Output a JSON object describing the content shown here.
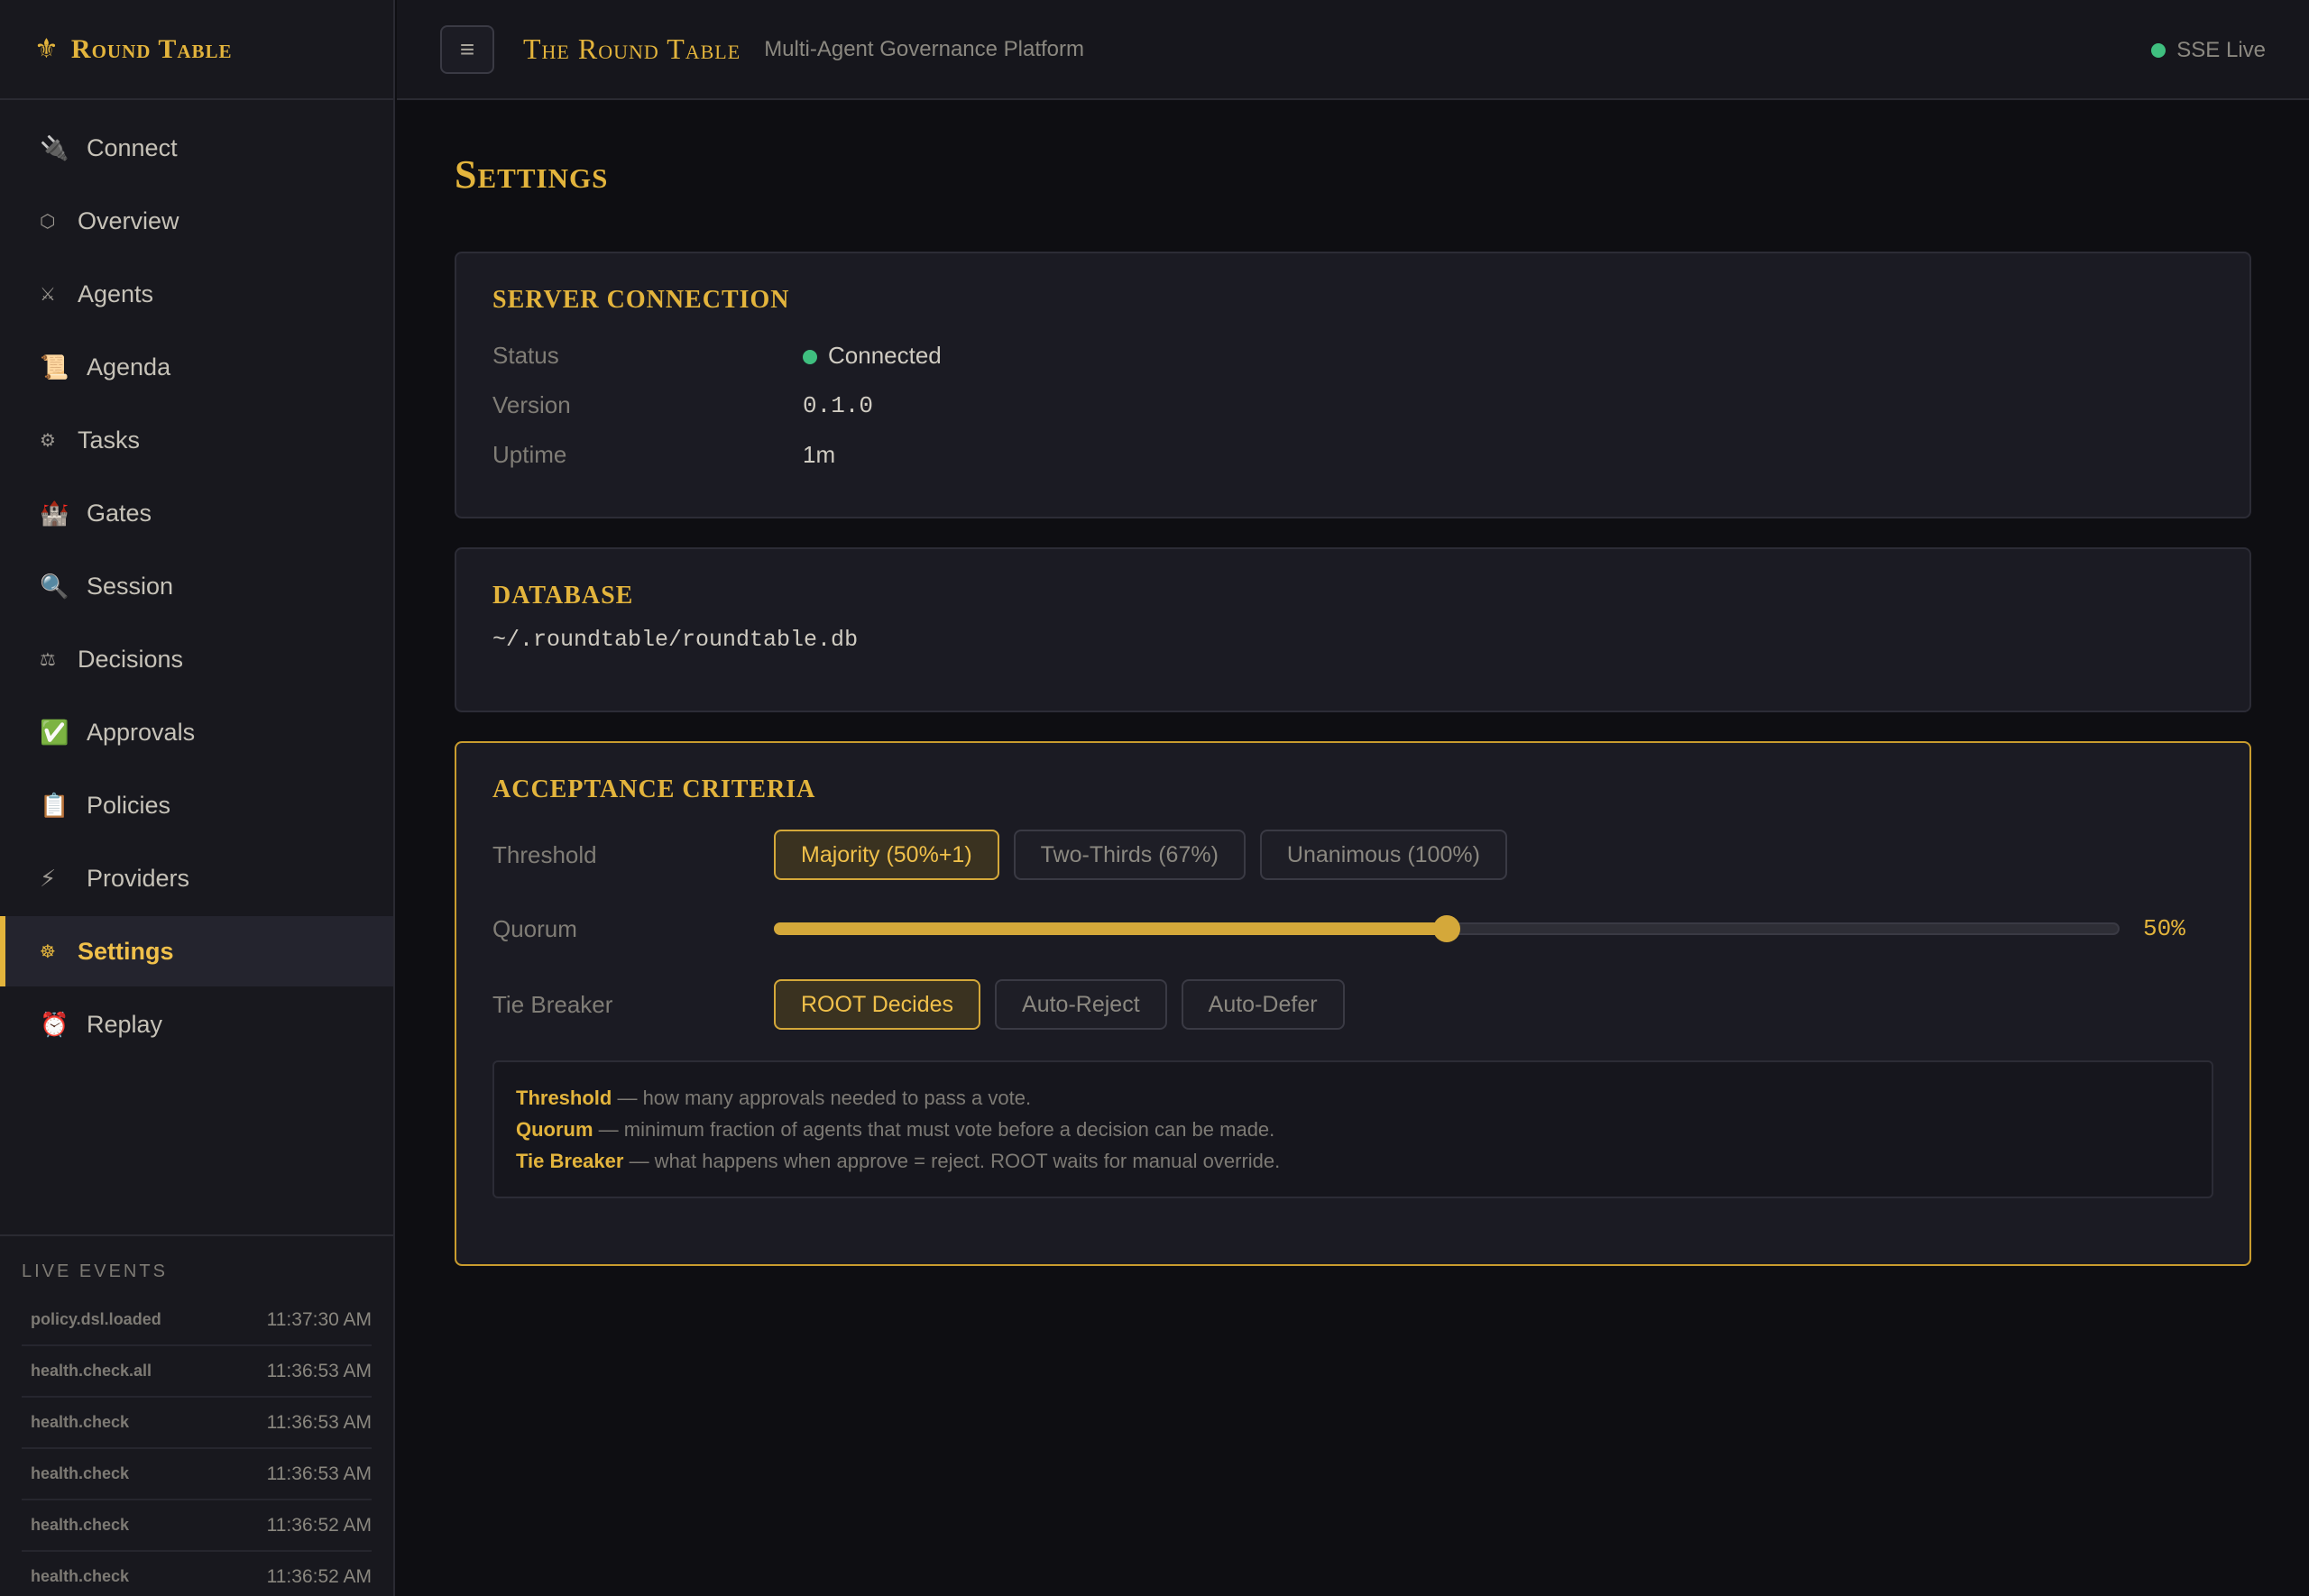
{
  "brand": {
    "icon": "fleur-de-lis-icon",
    "title": "Round Table"
  },
  "nav": [
    {
      "label": "Connect",
      "icon": "plug-icon",
      "glyph": "🔌"
    },
    {
      "label": "Overview",
      "icon": "hexagon-icon",
      "glyph": "⬡"
    },
    {
      "label": "Agents",
      "icon": "crossed-swords-icon",
      "glyph": "⚔"
    },
    {
      "label": "Agenda",
      "icon": "scroll-icon",
      "glyph": "📜"
    },
    {
      "label": "Tasks",
      "icon": "gear-icon",
      "glyph": "⚙"
    },
    {
      "label": "Gates",
      "icon": "castle-icon",
      "glyph": "🏰"
    },
    {
      "label": "Session",
      "icon": "magnifier-icon",
      "glyph": "🔍"
    },
    {
      "label": "Decisions",
      "icon": "scales-icon",
      "glyph": "⚖"
    },
    {
      "label": "Approvals",
      "icon": "check-box-icon",
      "glyph": "✅"
    },
    {
      "label": "Policies",
      "icon": "clipboard-icon",
      "glyph": "📋"
    },
    {
      "label": "Providers",
      "icon": "lightning-icon",
      "glyph": "⚡"
    },
    {
      "label": "Settings",
      "icon": "settings-gear-icon",
      "glyph": "☸"
    },
    {
      "label": "Replay",
      "icon": "alarm-clock-icon",
      "glyph": "⏰"
    }
  ],
  "events": {
    "title": "LIVE EVENTS",
    "items": [
      {
        "name": "policy.dsl.loaded",
        "time": "11:37:30 AM"
      },
      {
        "name": "health.check.all",
        "time": "11:36:53 AM"
      },
      {
        "name": "health.check",
        "time": "11:36:53 AM"
      },
      {
        "name": "health.check",
        "time": "11:36:53 AM"
      },
      {
        "name": "health.check",
        "time": "11:36:52 AM"
      },
      {
        "name": "health.check",
        "time": "11:36:52 AM"
      }
    ]
  },
  "header": {
    "menu_icon": "hamburger-menu-icon",
    "title": "The Round Table",
    "subtitle": "Multi-Agent Governance Platform",
    "status": "SSE Live",
    "status_color": "#3fbf7f"
  },
  "page": {
    "title": "Settings"
  },
  "server": {
    "title": "SERVER CONNECTION",
    "status_label": "Status",
    "status_value": "Connected",
    "version_label": "Version",
    "version_value": "0.1.0",
    "uptime_label": "Uptime",
    "uptime_value": "1m"
  },
  "database": {
    "title": "DATABASE",
    "path": "~/.roundtable/roundtable.db"
  },
  "criteria": {
    "title": "ACCEPTANCE CRITERIA",
    "threshold_label": "Threshold",
    "threshold_options": [
      "Majority (50%+1)",
      "Two-Thirds (67%)",
      "Unanimous (100%)"
    ],
    "threshold_selected": "Majority (50%+1)",
    "quorum_label": "Quorum",
    "quorum_value": 0.5,
    "quorum_display": "50%",
    "tiebreaker_label": "Tie Breaker",
    "tiebreaker_options": [
      "ROOT Decides",
      "Auto-Reject",
      "Auto-Defer"
    ],
    "tiebreaker_selected": "ROOT Decides",
    "help": [
      {
        "term": "Threshold",
        "text": " — how many approvals needed to pass a vote."
      },
      {
        "term": "Quorum",
        "text": " — minimum fraction of agents that must vote before a decision can be made."
      },
      {
        "term": "Tie Breaker",
        "text": " — what happens when approve = reject. ROOT waits for manual override."
      }
    ]
  },
  "colors": {
    "accent": "#e3b43c",
    "success": "#3fbf7f",
    "background": "#0e0e12"
  }
}
